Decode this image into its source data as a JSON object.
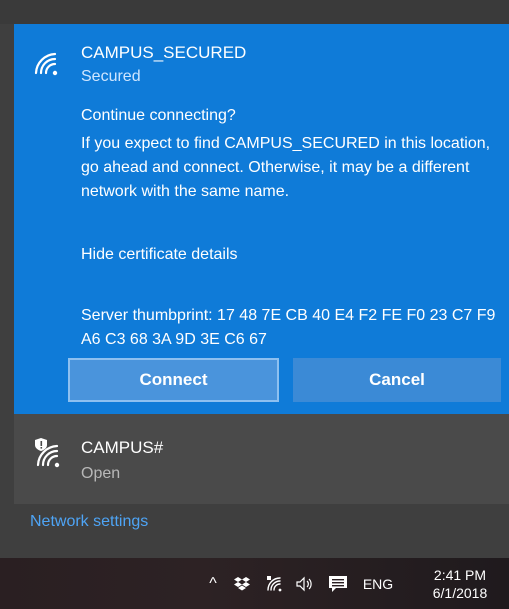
{
  "colors": {
    "accent": "#0f7bd8",
    "link": "#4ea4f5"
  },
  "active_network": {
    "name": "CAMPUS_SECURED",
    "status": "Secured",
    "prompt_title": "Continue connecting?",
    "prompt_body": "If you expect to find CAMPUS_SECURED in this location, go ahead and connect. Otherwise, it may be a different network with the same name.",
    "cert_link": "Hide certificate details",
    "thumbprint": "Server thumbprint: 17 48 7E CB 40 E4 F2 FE F0 23 C7 F9 A6 C3 68 3A 9D 3E C6 67",
    "connect_label": "Connect",
    "cancel_label": "Cancel",
    "icon": "wifi-secured-icon"
  },
  "other_network": {
    "name": "CAMPUS#",
    "status": "Open",
    "icon": "wifi-open-shield-icon"
  },
  "network_settings": "Network settings",
  "taskbar": {
    "icons": [
      "chevron-up-icon",
      "dropbox-icon",
      "wifi-icon",
      "volume-icon",
      "action-center-icon"
    ],
    "language": "ENG",
    "time": "2:41 PM",
    "date": "6/1/2018"
  }
}
